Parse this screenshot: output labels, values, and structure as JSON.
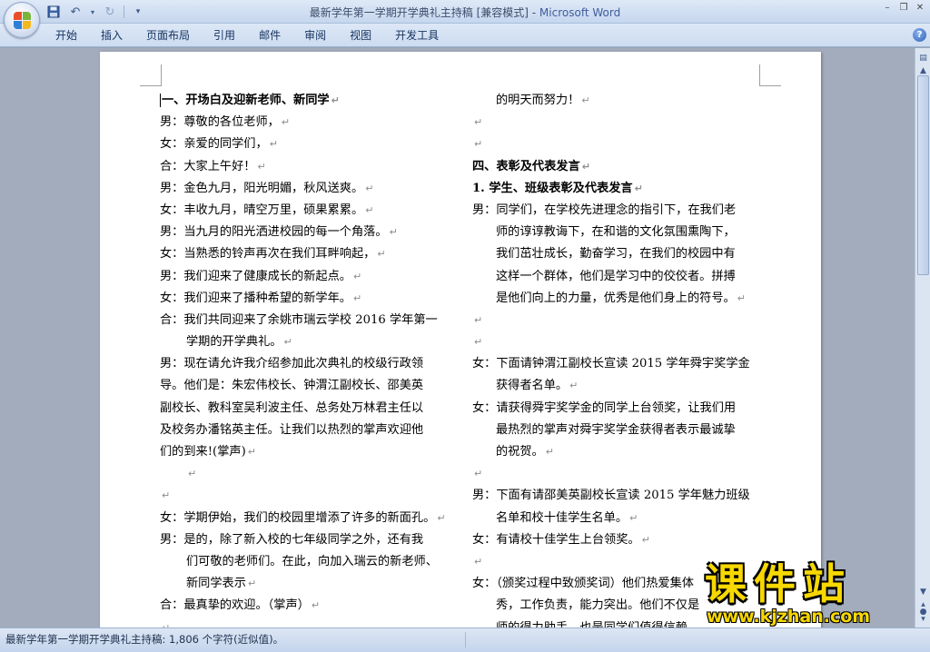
{
  "window": {
    "title_doc": "最新学年第一学期开学典礼主持稿 [兼容模式] - ",
    "title_app": "Microsoft Word"
  },
  "tabs": [
    "开始",
    "插入",
    "页面布局",
    "引用",
    "邮件",
    "审阅",
    "视图",
    "开发工具"
  ],
  "document": {
    "left_column": [
      {
        "text": "一、开场白及迎新老师、新同学",
        "style": "bold",
        "mark": "↵",
        "cursor": true
      },
      {
        "text": "男：尊敬的各位老师，",
        "mark": "↵"
      },
      {
        "text": "女：亲爱的同学们，",
        "mark": "↵"
      },
      {
        "text": "合：大家上午好！",
        "mark": "↵"
      },
      {
        "text": "男：金色九月，阳光明媚，秋风送爽。",
        "mark": "↵"
      },
      {
        "text": "女：丰收九月，晴空万里，硕果累累。",
        "mark": "↵"
      },
      {
        "text": "男：当九月的阳光洒进校园的每一个角落。",
        "mark": "↵"
      },
      {
        "text": "女：当熟悉的铃声再次在我们耳畔响起，",
        "mark": "↵"
      },
      {
        "text": "男：我们迎来了健康成长的新起点。",
        "mark": "↵"
      },
      {
        "text": "女：我们迎来了播种希望的新学年。",
        "mark": "↵"
      },
      {
        "text": "合：我们共同迎来了余姚市瑞云学校 2016 学年第一",
        "mark": ""
      },
      {
        "text": "学期的开学典礼。",
        "style": "ind",
        "mark": "↵"
      },
      {
        "text": "男：现在请允许我介绍参加此次典礼的校级行政领",
        "mark": ""
      },
      {
        "text": "导。他们是：朱宏伟校长、钟渭江副校长、邵美英",
        "mark": ""
      },
      {
        "text": "副校长、教科室吴利波主任、总务处万林君主任以",
        "mark": ""
      },
      {
        "text": "及校务办潘铭英主任。让我们以热烈的掌声欢迎他",
        "mark": ""
      },
      {
        "text": "们的到来!(掌声)",
        "mark": "↵"
      },
      {
        "text": "",
        "style": "ind",
        "mark": "↵"
      },
      {
        "text": "",
        "mark": "↵"
      },
      {
        "text": "女：学期伊始，我们的校园里增添了许多的新面孔。",
        "mark": "↵"
      },
      {
        "text": "男：是的，除了新入校的七年级同学之外，还有我",
        "mark": ""
      },
      {
        "text": "们可敬的老师们。在此，向加入瑞云的新老师、",
        "style": "ind",
        "mark": ""
      },
      {
        "text": "新同学表示",
        "style": "ind",
        "mark": "↵"
      },
      {
        "text": "合：最真挚的欢迎。（掌声）",
        "mark": "↵"
      },
      {
        "text": "",
        "mark": "↵"
      }
    ],
    "right_column": [
      {
        "text": "的明天而努力！",
        "style": "ind2",
        "mark": "↵"
      },
      {
        "text": "",
        "mark": "↵"
      },
      {
        "text": "",
        "mark": "↵"
      },
      {
        "text": "四、表彰及代表发言",
        "style": "bold",
        "mark": "↵"
      },
      {
        "text": "1. 学生、班级表彰及代表发言",
        "style": "bold",
        "mark": "↵"
      },
      {
        "text": "男：同学们，在学校先进理念的指引下，在我们老",
        "mark": ""
      },
      {
        "text": "师的谆谆教诲下，在和谐的文化氛围熏陶下，",
        "style": "ind2",
        "mark": ""
      },
      {
        "text": "我们茁壮成长，勤奋学习，在我们的校园中有",
        "style": "ind2",
        "mark": ""
      },
      {
        "text": "这样一个群体，他们是学习中的佼佼者。拼搏",
        "style": "ind2",
        "mark": ""
      },
      {
        "text": "是他们向上的力量，优秀是他们身上的符号。",
        "style": "ind2",
        "mark": "↵"
      },
      {
        "text": "",
        "mark": "↵"
      },
      {
        "text": "",
        "mark": "↵"
      },
      {
        "text": "女：下面请钟渭江副校长宣读 2015 学年舜宇奖学金",
        "mark": ""
      },
      {
        "text": "获得者名单。",
        "style": "ind2",
        "mark": "↵"
      },
      {
        "text": "女：请获得舜宇奖学金的同学上台领奖，让我们用",
        "mark": ""
      },
      {
        "text": "最热烈的掌声对舜宇奖学金获得者表示最诚挚",
        "style": "ind2",
        "mark": ""
      },
      {
        "text": "的祝贺。",
        "style": "ind2",
        "mark": "↵"
      },
      {
        "text": "",
        "mark": "↵"
      },
      {
        "text": "男：下面有请邵美英副校长宣读 2015 学年魅力班级",
        "mark": ""
      },
      {
        "text": "名单和校十佳学生名单。",
        "style": "ind2",
        "mark": "↵"
      },
      {
        "text": "女：有请校十佳学生上台领奖。",
        "mark": "↵"
      },
      {
        "text": "",
        "mark": "↵"
      },
      {
        "text": "女：（颁奖过程中致颁奖词）他们热爱集体",
        "mark": ""
      },
      {
        "text": "秀，工作负责，能力突出。他们不仅是",
        "style": "ind2",
        "mark": ""
      },
      {
        "text": "师的得力助手，也是同学们值得信赖",
        "style": "ind2",
        "mark": ""
      }
    ]
  },
  "status": {
    "text": "最新学年第一学期开学典礼主持稿: 1,806 个字符(近似值)。"
  },
  "watermark": {
    "main": "课件站",
    "url": "www.kjzhan.com"
  },
  "colors": {
    "watermark": "#f7d800",
    "office_red": "#e8502a",
    "office_green": "#7ab43b",
    "office_blue": "#2f7fd8",
    "office_yellow": "#f4b81c"
  }
}
